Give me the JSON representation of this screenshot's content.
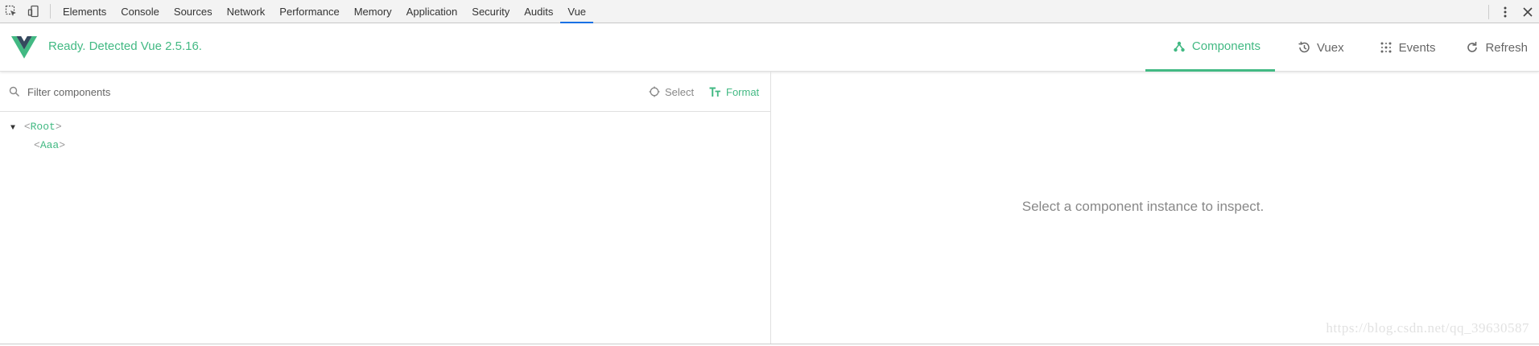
{
  "devtools": {
    "tabs": [
      "Elements",
      "Console",
      "Sources",
      "Network",
      "Performance",
      "Memory",
      "Application",
      "Security",
      "Audits",
      "Vue"
    ],
    "active_tab": "Vue",
    "icons": [
      "inspect-element-icon",
      "device-toolbar-icon",
      "more-options-icon",
      "close-icon"
    ]
  },
  "header": {
    "status": "Ready. Detected Vue 2.5.16.",
    "nav": [
      {
        "label": "Components",
        "icon": "components-icon",
        "active": true
      },
      {
        "label": "Vuex",
        "icon": "history-icon",
        "active": false
      },
      {
        "label": "Events",
        "icon": "events-icon",
        "active": false
      },
      {
        "label": "Refresh",
        "icon": "refresh-icon",
        "active": false
      }
    ]
  },
  "components_pane": {
    "filter_placeholder": "Filter components",
    "filter_value": "",
    "select_label": "Select",
    "format_label": "Format",
    "tree": [
      {
        "name": "Root",
        "expanded": true
      },
      {
        "name": "Aaa"
      }
    ]
  },
  "inspector": {
    "empty_message": "Select a component instance to inspect."
  },
  "watermark": "https://blog.csdn.net/qq_39630587",
  "colors": {
    "accent": "#42b983",
    "devtools_active": "#1a73e8",
    "muted": "#888888"
  }
}
